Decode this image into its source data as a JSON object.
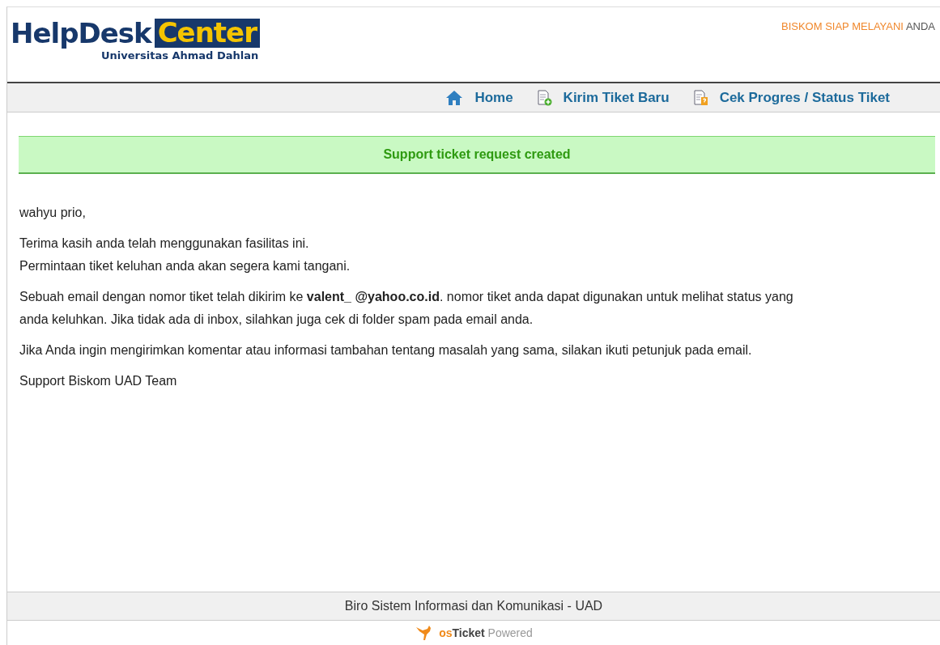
{
  "header": {
    "logo_main": "HelpDesk",
    "logo_box": "Center",
    "logo_sub": "Universitas Ahmad Dahlan",
    "tagline_highlight": "BISKOM SIAP MELAYANI",
    "tagline_rest": "ANDA"
  },
  "nav": [
    {
      "kind": "home",
      "label": "Home"
    },
    {
      "kind": "new",
      "label": "Kirim Tiket Baru"
    },
    {
      "kind": "status",
      "label": "Cek Progres / Status Tiket"
    }
  ],
  "notice": "Support ticket request created",
  "paragraphs": [
    "wahyu prio,",
    "Terima kasih anda telah menggunakan fasilitas ini.\nPermintaan tiket keluhan anda akan segera kami tangani.",
    "Sebuah email dengan nomor tiket telah dikirim ke **valent_            @yahoo.co.id**. nomor tiket anda dapat digunakan untuk melihat status yang anda keluhkan. Jika tidak ada di inbox, silahkan juga cek di folder spam pada email anda.",
    "Jika Anda ingin mengirimkan komentar atau informasi tambahan tentang masalah yang sama, silakan ikuti petunjuk pada email.",
    "Support Biskom UAD Team"
  ],
  "footer": {
    "text": "Biro Sistem Informasi dan Komunikasi - UAD",
    "brand_os": "os",
    "brand_ticket": "Ticket",
    "brand_powered": "Powered"
  }
}
